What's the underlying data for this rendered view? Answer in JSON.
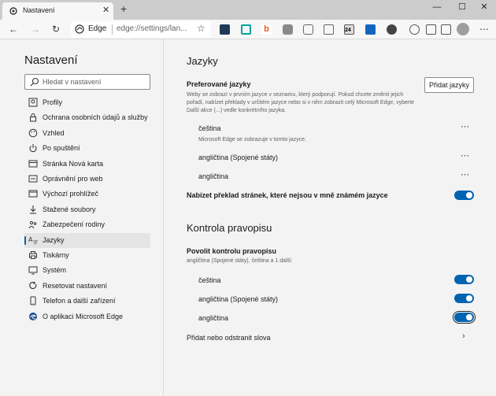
{
  "window": {
    "tab_title": "Nastavení",
    "new_tab_glyph": "+",
    "tab_close_glyph": "✕",
    "minimize_glyph": "—",
    "maximize_glyph": "☐",
    "close_glyph": "✕"
  },
  "toolbar": {
    "back_glyph": "←",
    "forward_glyph": "→",
    "refresh_glyph": "↻",
    "brand": "Edge",
    "url": "edge://settings/lan...",
    "favorite_glyph": "☆",
    "extension_icons": [
      "keyboard-icon",
      "copy-icon",
      "b-icon",
      "recycle-icon",
      "camera-icon",
      "image-icon",
      "calendar-icon",
      "download-icon",
      "video-icon",
      "sync-icon",
      "collections-icon",
      "favorites-icon",
      "avatar",
      "more-icon"
    ],
    "badge_text": "24",
    "more_glyph": "⋯"
  },
  "sidebar": {
    "title": "Nastavení",
    "search_placeholder": "Hledat v nastavení",
    "items": [
      {
        "label": "Profily",
        "icon": "profile-icon"
      },
      {
        "label": "Ochrana osobních údajů a služby",
        "icon": "lock-icon"
      },
      {
        "label": "Vzhled",
        "icon": "palette-icon"
      },
      {
        "label": "Po spuštění",
        "icon": "power-icon"
      },
      {
        "label": "Stránka Nová karta",
        "icon": "newtab-icon"
      },
      {
        "label": "Oprávnění pro web",
        "icon": "site-permissions-icon"
      },
      {
        "label": "Výchozí prohlížeč",
        "icon": "browser-icon"
      },
      {
        "label": "Stažené soubory",
        "icon": "download-icon"
      },
      {
        "label": "Zabezpečení rodiny",
        "icon": "family-icon"
      },
      {
        "label": "Jazyky",
        "icon": "language-icon",
        "active": true
      },
      {
        "label": "Tiskárny",
        "icon": "printer-icon"
      },
      {
        "label": "Systém",
        "icon": "system-icon"
      },
      {
        "label": "Resetovat nastavení",
        "icon": "reset-icon"
      },
      {
        "label": "Telefon a další zařízení",
        "icon": "phone-icon"
      },
      {
        "label": "O aplikaci Microsoft Edge",
        "icon": "edge-icon"
      }
    ]
  },
  "main": {
    "languages_heading": "Jazyky",
    "preferred_heading": "Preferované jazyky",
    "preferred_desc": "Weby se zobrazí v prvním jazyce v seznamu, který podporují. Pokud chcete změnit jejich pořadí, nabízet překlady v určitém jazyce nebo si v něm zobrazit celý Microsoft Edge, vyberte Další akce (...) vedle konkrétního jazyka.",
    "add_languages_button": "Přidat jazyky",
    "languages": [
      {
        "name": "čeština",
        "note": "Microsoft Edge se zobrazuje v tomto jazyce."
      },
      {
        "name": "angličtina (Spojené státy)",
        "note": ""
      },
      {
        "name": "angličtina",
        "note": ""
      }
    ],
    "more_glyph": "⋯",
    "offer_translate_label": "Nabízet překlad stránek, které nejsou v mně známém jazyce",
    "offer_translate_on": true,
    "spellcheck_heading": "Kontrola pravopisu",
    "enable_spellcheck_label": "Povolit kontrolu pravopisu",
    "enable_spellcheck_summary": "angličtina (Spojené státy), čeština a 1 další",
    "spellcheck_languages": [
      {
        "name": "čeština",
        "on": true
      },
      {
        "name": "angličtina (Spojené státy)",
        "on": true
      },
      {
        "name": "angličtina",
        "on": true,
        "focused": true
      }
    ],
    "add_remove_words_label": "Přidat nebo odstranit slova",
    "chevron_glyph": "›"
  },
  "colors": {
    "accent": "#0063b1",
    "background": "#f3f3f3",
    "titlebar": "#cccccc"
  }
}
